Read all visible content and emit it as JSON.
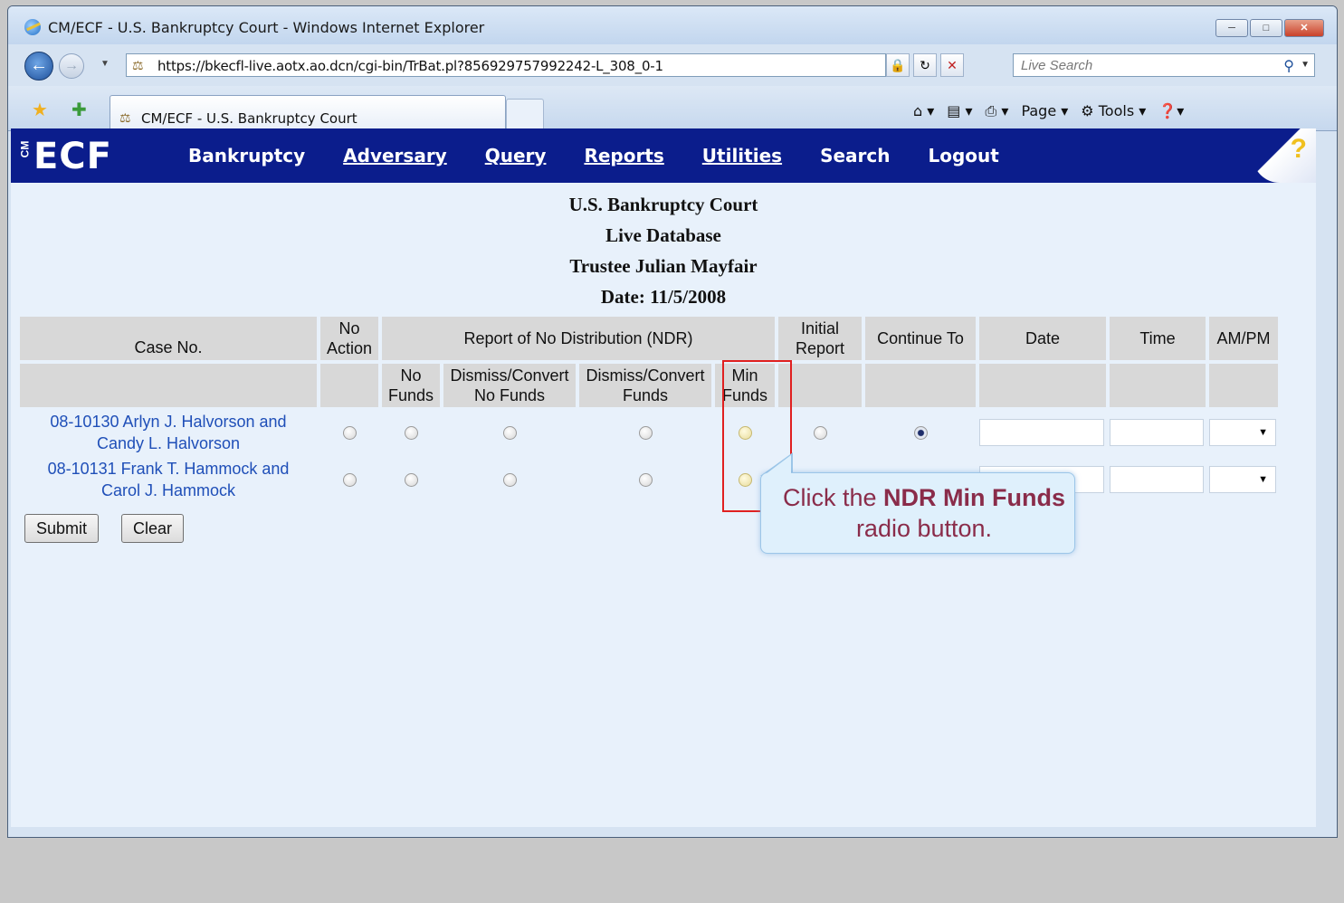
{
  "window": {
    "title": "CM/ECF - U.S. Bankruptcy Court - Windows Internet Explorer",
    "address": "https://bkecfl-live.aotx.ao.dcn/cgi-bin/TrBat.pl?856929757992242-L_308_0-1",
    "search_placeholder": "Live Search",
    "tab_title": "CM/ECF - U.S. Bankruptcy Court",
    "cmd_page": "Page",
    "cmd_tools": "Tools"
  },
  "banner": {
    "logo": "ECF",
    "logo_cm": "CM",
    "menu": {
      "bankruptcy": "Bankruptcy",
      "adversary": "Adversary",
      "query": "Query",
      "reports": "Reports",
      "utilities": "Utilities",
      "search": "Search",
      "logout": "Logout"
    }
  },
  "header": {
    "court": "U.S. Bankruptcy Court",
    "database": "Live Database",
    "trustee": "Trustee Julian Mayfair",
    "date": "Date: 11/5/2008"
  },
  "table": {
    "headers": {
      "case_no": "Case No.",
      "no_action_1": "No",
      "no_action_2": "Action",
      "ndr": "Report of No Distribution (NDR)",
      "initial_1": "Initial",
      "initial_2": "Report",
      "continue_to": "Continue To",
      "date": "Date",
      "time": "Time",
      "ampm": "AM/PM",
      "no_funds_1": "No",
      "no_funds_2": "Funds",
      "dc_nofunds_1": "Dismiss/Convert",
      "dc_nofunds_2": "No Funds",
      "dc_funds_1": "Dismiss/Convert",
      "dc_funds_2": "Funds",
      "min_funds_1": "Min",
      "min_funds_2": "Funds"
    },
    "rows": [
      {
        "case_line1": "08-10130 Arlyn J. Halvorson and",
        "case_line2": "Candy L. Halvorson"
      },
      {
        "case_line1": "08-10131 Frank T. Hammock and",
        "case_line2": "Carol J. Hammock"
      }
    ]
  },
  "buttons": {
    "submit": "Submit",
    "clear": "Clear"
  },
  "callout": {
    "pre": "Click the ",
    "bold": "NDR Min Funds",
    "post": " radio button."
  }
}
